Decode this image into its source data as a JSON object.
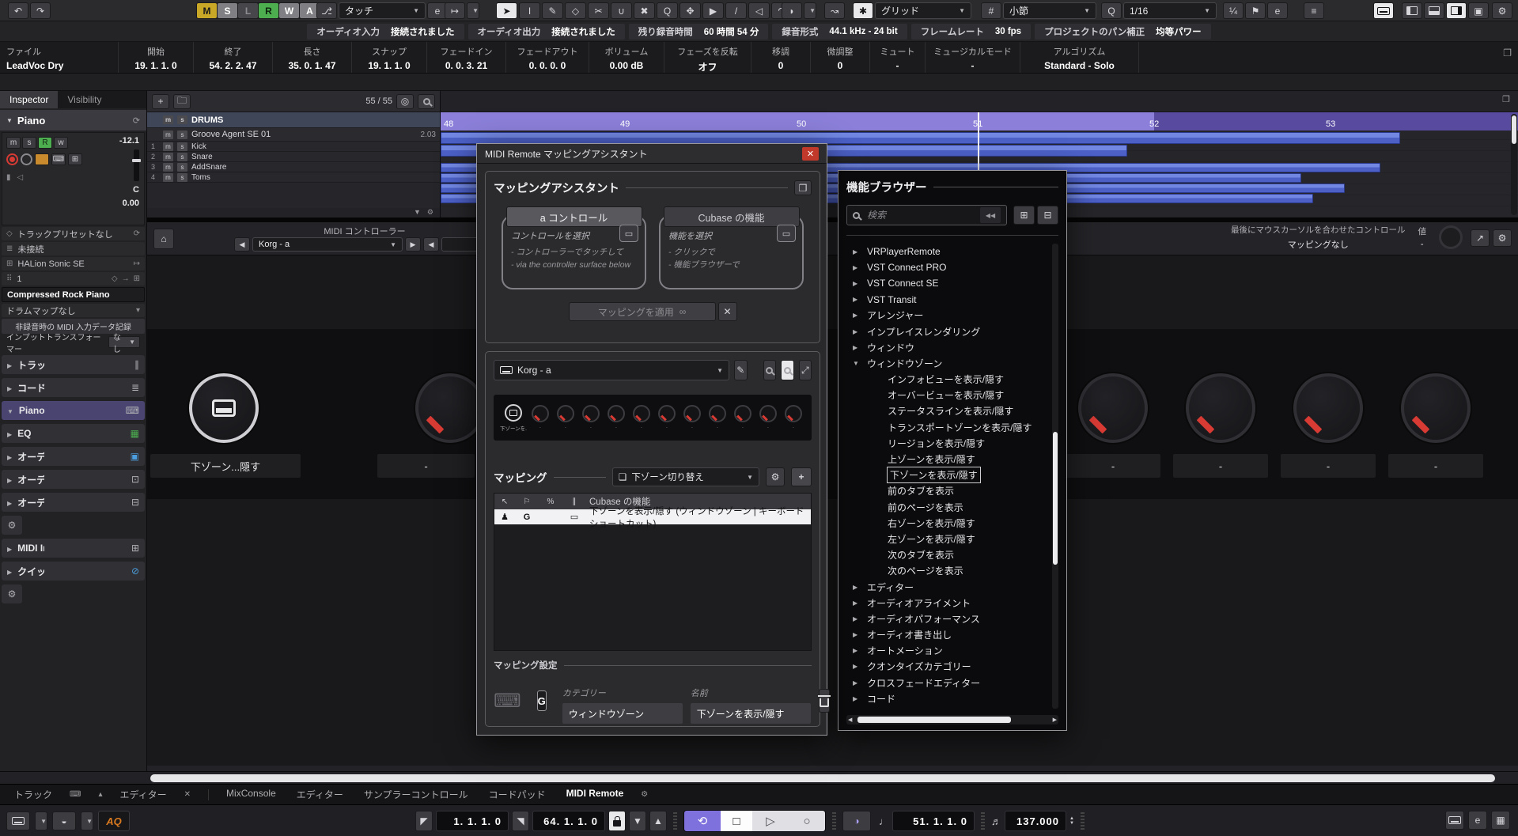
{
  "colors": {
    "accent_purple": "#7f71dd",
    "record_red": "#d83a34",
    "automation_yellow": "#c9a727",
    "automation_green": "#4cae4f",
    "event_blue": "#5b6fd0",
    "ruler_purple": "#8a7ed8",
    "close_red": "#c0392b",
    "logo_orange": "#d97a1f"
  },
  "toolbar": {
    "automation_buttons": [
      {
        "l": "M",
        "cls": "am-m"
      },
      {
        "l": "S",
        "cls": "am-s"
      },
      {
        "l": "L",
        "cls": "am-l"
      },
      {
        "l": "R",
        "cls": "am-r"
      },
      {
        "l": "W",
        "cls": "am-w"
      },
      {
        "l": "A",
        "cls": "am-a"
      }
    ],
    "automation_mode": "タッチ",
    "edit_label": "e",
    "tools": [
      {
        "glyph": "➤",
        "cls": "active"
      },
      {
        "glyph": "I"
      },
      {
        "glyph": "✎"
      },
      {
        "glyph": "◇"
      },
      {
        "glyph": "✂"
      },
      {
        "glyph": "∪"
      },
      {
        "glyph": "✖"
      },
      {
        "glyph": "Q"
      },
      {
        "glyph": "✥"
      },
      {
        "glyph": "▶"
      },
      {
        "glyph": "/"
      },
      {
        "glyph": "◁"
      },
      {
        "glyph": "↷"
      }
    ],
    "snap_label": "グリッド",
    "grid_hash": "#",
    "grid_label": "小節",
    "quantize_label": "Q",
    "quantize_value": "1/16"
  },
  "statusline": [
    {
      "label": "オーディオ入力",
      "value": "接続されました"
    },
    {
      "label": "オーディオ出力",
      "value": "接続されました"
    },
    {
      "label": "残り録音時間",
      "value": "60 時間 54 分"
    },
    {
      "label": "録音形式",
      "value": "44.1 kHz - 24 bit"
    },
    {
      "label": "フレームレート",
      "value": "30 fps"
    },
    {
      "label": "プロジェクトのパン補正",
      "value": "均等パワー"
    }
  ],
  "infoline": [
    {
      "label": "ファイル",
      "value": "LeadVoc Dry",
      "cls": "first w150"
    },
    {
      "label": "開始",
      "value": "19. 1. 1. 0",
      "cls": "w95"
    },
    {
      "label": "終了",
      "value": "54. 2. 2. 47",
      "cls": "w100"
    },
    {
      "label": "長さ",
      "value": "35. 0. 1. 47",
      "cls": "w100"
    },
    {
      "label": "スナップ",
      "value": "19. 1. 1. 0",
      "cls": "w95"
    },
    {
      "label": "フェードイン",
      "value": "0. 0. 3. 21",
      "cls": "w100"
    },
    {
      "label": "フェードアウト",
      "value": "0. 0. 0. 0",
      "cls": "w105"
    },
    {
      "label": "ボリューム",
      "value": "0.00 dB",
      "cls": "w95"
    },
    {
      "label": "フェーズを反転",
      "value": "オフ",
      "cls": "w110"
    },
    {
      "label": "移調",
      "value": "0",
      "cls": "w75"
    },
    {
      "label": "微調整",
      "value": "0",
      "cls": "w75"
    },
    {
      "label": "ミュート",
      "value": "-",
      "cls": "w70"
    },
    {
      "label": "ミュージカルモード",
      "value": "-",
      "cls": "w120"
    },
    {
      "label": "アルゴリズム",
      "value": "Standard - Solo",
      "cls": "w150"
    }
  ],
  "inspector": {
    "tabs": [
      {
        "label": "Inspector",
        "cls": "active"
      },
      {
        "label": "Visibility"
      }
    ],
    "track_name": "Piano",
    "track_buttons": [
      {
        "l": "m"
      },
      {
        "l": "s"
      },
      {
        "l": "R",
        "cls": "green"
      },
      {
        "l": "w"
      }
    ],
    "gain": "-12.1",
    "pan": "C",
    "volume": "0.00",
    "rows": {
      "preset": "トラックプリセットなし",
      "input": "未接続",
      "instrument": "HALion Sonic SE",
      "channel": "1",
      "patch": "Compressed Rock Piano",
      "drum_map": "ドラムマップなし",
      "record_midi": "非録音時の MIDI 入力データ記録",
      "transformer": "インプットトランスフォーマー",
      "transformer_value": "なし"
    },
    "sections": [
      {
        "label": "トラックバージョン",
        "icon": "∥",
        "cls": ""
      },
      {
        "label": "コード",
        "icon": "≣",
        "cls": ""
      },
      {
        "label": "Piano",
        "icon": "⌨",
        "cls": "selected"
      },
      {
        "label": "EQ",
        "icon": "▦",
        "cls": "",
        "icon_cls": "green"
      },
      {
        "label": "オーディオ Inserts",
        "icon": "▣",
        "cls": "",
        "icon_cls": "blue"
      },
      {
        "label": "オーディオ Sends",
        "icon": "⊡",
        "cls": ""
      },
      {
        "label": "オーディオフェーダー",
        "icon": "⊟",
        "cls": ""
      },
      {
        "label": "",
        "icon": "⚙",
        "cls": "mini"
      },
      {
        "label": "MIDI Inserts",
        "icon": "⊞",
        "cls": ""
      },
      {
        "label": "クイックコントロール",
        "icon": "⊘",
        "cls": "",
        "icon_cls": "blue"
      },
      {
        "label": "",
        "icon": "⚙",
        "cls": "mini"
      }
    ]
  },
  "tracklist": {
    "counter": "55 / 55",
    "tracks": [
      {
        "num": "",
        "name": "DRUMS",
        "cls": "folder",
        "m": "m",
        "s": "s",
        "value": ""
      },
      {
        "num": "",
        "name": "Groove Agent SE 01",
        "cls": "instrument",
        "m": "m",
        "s": "s",
        "value": "2.03"
      },
      {
        "num": "1",
        "name": "Kick",
        "cls": "audio",
        "m": "m",
        "s": "s",
        "value": ""
      },
      {
        "num": "2",
        "name": "Snare",
        "cls": "audio",
        "m": "m",
        "s": "s",
        "value": ""
      },
      {
        "num": "3",
        "name": "AddSnare",
        "cls": "audio",
        "m": "m",
        "s": "s",
        "value": ""
      },
      {
        "num": "4",
        "name": "Toms",
        "cls": "audio",
        "m": "m",
        "s": "s",
        "value": ""
      }
    ]
  },
  "ruler": {
    "ticks": [
      {
        "t": "48"
      },
      {
        "t": "49"
      },
      {
        "t": "50"
      },
      {
        "t": "51"
      },
      {
        "t": "52"
      },
      {
        "t": "53"
      }
    ]
  },
  "lowerzone": {
    "midi_controller_label": "MIDI コントローラー",
    "controller_name": "Korg - a",
    "last_control_label": "最後にマウスカーソルを合わせたコントロール",
    "value_label": "値",
    "mapping_status": "マッピングなし",
    "value": "-",
    "left_knob_label": "下ゾーン...隠す",
    "dash": "-"
  },
  "dialog": {
    "title": "MIDI Remote マッピングアシスタント",
    "close": "✕",
    "assistant": {
      "heading": "マッピングアシスタント",
      "control_tab": "a コントロール",
      "function_tab": "Cubase の機能",
      "control_hint_title": "コントロールを選択",
      "control_hint_1": "- コントローラーでタッチして",
      "control_hint_2": "- via the controller surface below",
      "function_hint_title": "機能を選択",
      "function_hint_1": "- クリックで",
      "function_hint_2": "- 機能ブラウザーで",
      "apply_label": "マッピングを適用"
    },
    "controller_name": "Korg - a",
    "surface_knobs": [
      {
        "label": "下ゾーンを..隠す",
        "cls": "sel"
      },
      {
        "label": "·"
      },
      {
        "label": "·"
      },
      {
        "label": "·"
      },
      {
        "label": "·"
      },
      {
        "label": "·"
      },
      {
        "label": "·"
      },
      {
        "label": "·"
      },
      {
        "label": "·"
      },
      {
        "label": "·"
      },
      {
        "label": "·"
      },
      {
        "label": "·"
      }
    ],
    "mapping": {
      "heading": "マッピング",
      "page": "下ゾーン切り替え",
      "table_function_col": "Cubase の機能",
      "row_flag": "G",
      "row_text": "下ゾーンを表示/隠す (ウィンドウゾーン | キーボードショートカット)"
    },
    "settings": {
      "heading": "マッピング設定",
      "g": "G",
      "category_label": "カテゴリー",
      "category_value": "ウィンドウゾーン",
      "name_label": "名前",
      "name_value": "下ゾーンを表示/隠す"
    }
  },
  "browser": {
    "title": "機能ブラウザー",
    "search_placeholder": "検索",
    "tree": [
      {
        "label": "VRPlayerRemote",
        "cls": "parent"
      },
      {
        "label": "VST Connect PRO",
        "cls": "parent"
      },
      {
        "label": "VST Connect SE",
        "cls": "parent"
      },
      {
        "label": "VST Transit",
        "cls": "parent"
      },
      {
        "label": "アレンジャー",
        "cls": "parent"
      },
      {
        "label": "インプレイスレンダリング",
        "cls": "parent"
      },
      {
        "label": "ウィンドウ",
        "cls": "parent"
      },
      {
        "label": "ウィンドウゾーン",
        "cls": "parent expanded"
      },
      {
        "label": "インフォビューを表示/隠す",
        "cls": "child"
      },
      {
        "label": "オーバービューを表示/隠す",
        "cls": "child"
      },
      {
        "label": "ステータスラインを表示/隠す",
        "cls": "child"
      },
      {
        "label": "トランスポートゾーンを表示/隠す",
        "cls": "child"
      },
      {
        "label": "リージョンを表示/隠す",
        "cls": "child"
      },
      {
        "label": "上ゾーンを表示/隠す",
        "cls": "child"
      },
      {
        "label": "下ゾーンを表示/隠す",
        "cls": "child selected"
      },
      {
        "label": "前のタブを表示",
        "cls": "child"
      },
      {
        "label": "前のページを表示",
        "cls": "child"
      },
      {
        "label": "右ゾーンを表示/隠す",
        "cls": "child"
      },
      {
        "label": "左ゾーンを表示/隠す",
        "cls": "child"
      },
      {
        "label": "次のタブを表示",
        "cls": "child"
      },
      {
        "label": "次のページを表示",
        "cls": "child"
      },
      {
        "label": "エディター",
        "cls": "parent"
      },
      {
        "label": "オーディオアライメント",
        "cls": "parent"
      },
      {
        "label": "オーディオパフォーマンス",
        "cls": "parent"
      },
      {
        "label": "オーディオ書き出し",
        "cls": "parent"
      },
      {
        "label": "オートメーション",
        "cls": "parent"
      },
      {
        "label": "クオンタイズカテゴリー",
        "cls": "parent"
      },
      {
        "label": "クロスフェードエディター",
        "cls": "parent"
      },
      {
        "label": "コード",
        "cls": "parent"
      }
    ]
  },
  "bottombar": {
    "track_tab": "トラック",
    "editor_tab": "エディター",
    "tabs": [
      {
        "label": "MixConsole",
        "cls": ""
      },
      {
        "label": "エディター",
        "cls": ""
      },
      {
        "label": "サンプラーコントロール",
        "cls": ""
      },
      {
        "label": "コードパッド",
        "cls": ""
      },
      {
        "label": "MIDI Remote",
        "cls": "active"
      }
    ]
  },
  "transport": {
    "left_locator": "1. 1. 1. 0",
    "right_locator": "64. 1. 1. 0",
    "position": "51. 1. 1. 0",
    "tempo": "137.000",
    "logo": "AQ"
  }
}
